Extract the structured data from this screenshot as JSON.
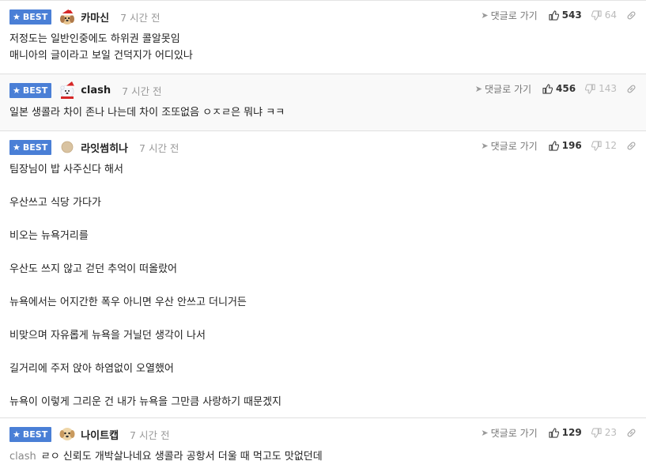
{
  "common": {
    "best_label": "BEST",
    "reply_label": "댓글로 가기"
  },
  "comments": [
    {
      "nickname": "카마신",
      "time": "7 시간 전",
      "up": "543",
      "down": "64",
      "avatar": "puppy-santa-icon",
      "lines": [
        "저정도는 일반인중에도 하위권 콜알못임",
        "매니아의 글이라고 보일 건덕지가 어디있나"
      ]
    },
    {
      "nickname": "clash",
      "time": "7 시간 전",
      "up": "456",
      "down": "143",
      "avatar": "polar-bear-santa-icon",
      "lines": [
        "일본 생콜라 차이 존나 나는데 차이 조또없음 ㅇㅈㄹ은 뭐냐 ㅋㅋ"
      ]
    },
    {
      "nickname": "라잇썸히나",
      "time": "7 시간 전",
      "up": "196",
      "down": "12",
      "avatar": "beige-circle-icon",
      "lines": [
        "팀장님이 밥 사주신다 해서",
        "우산쓰고 식당 가다가",
        "비오는 뉴욕거리를",
        "우산도 쓰지 않고 걷던 추억이 떠올랐어",
        "뉴욕에서는 어지간한 폭우 아니면 우산 안쓰고 더니거든",
        "비맞으며 자유롭게 뉴욕을 거닐던 생각이 나서",
        "길거리에 주저 앉아 하염없이 오열했어",
        "뉴욕이 이렇게 그리운 건 내가 뉴욕을 그만큼 사랑하기 때문겠지"
      ]
    },
    {
      "nickname": "나이트캡",
      "time": "7 시간 전",
      "up": "129",
      "down": "23",
      "avatar": "puppy-icon",
      "mention": "clash",
      "lines": [
        "ㄹㅇ 신뢰도 개박살나네요 생콜라 공항서 더울 때 먹고도 맛없던데"
      ]
    }
  ]
}
